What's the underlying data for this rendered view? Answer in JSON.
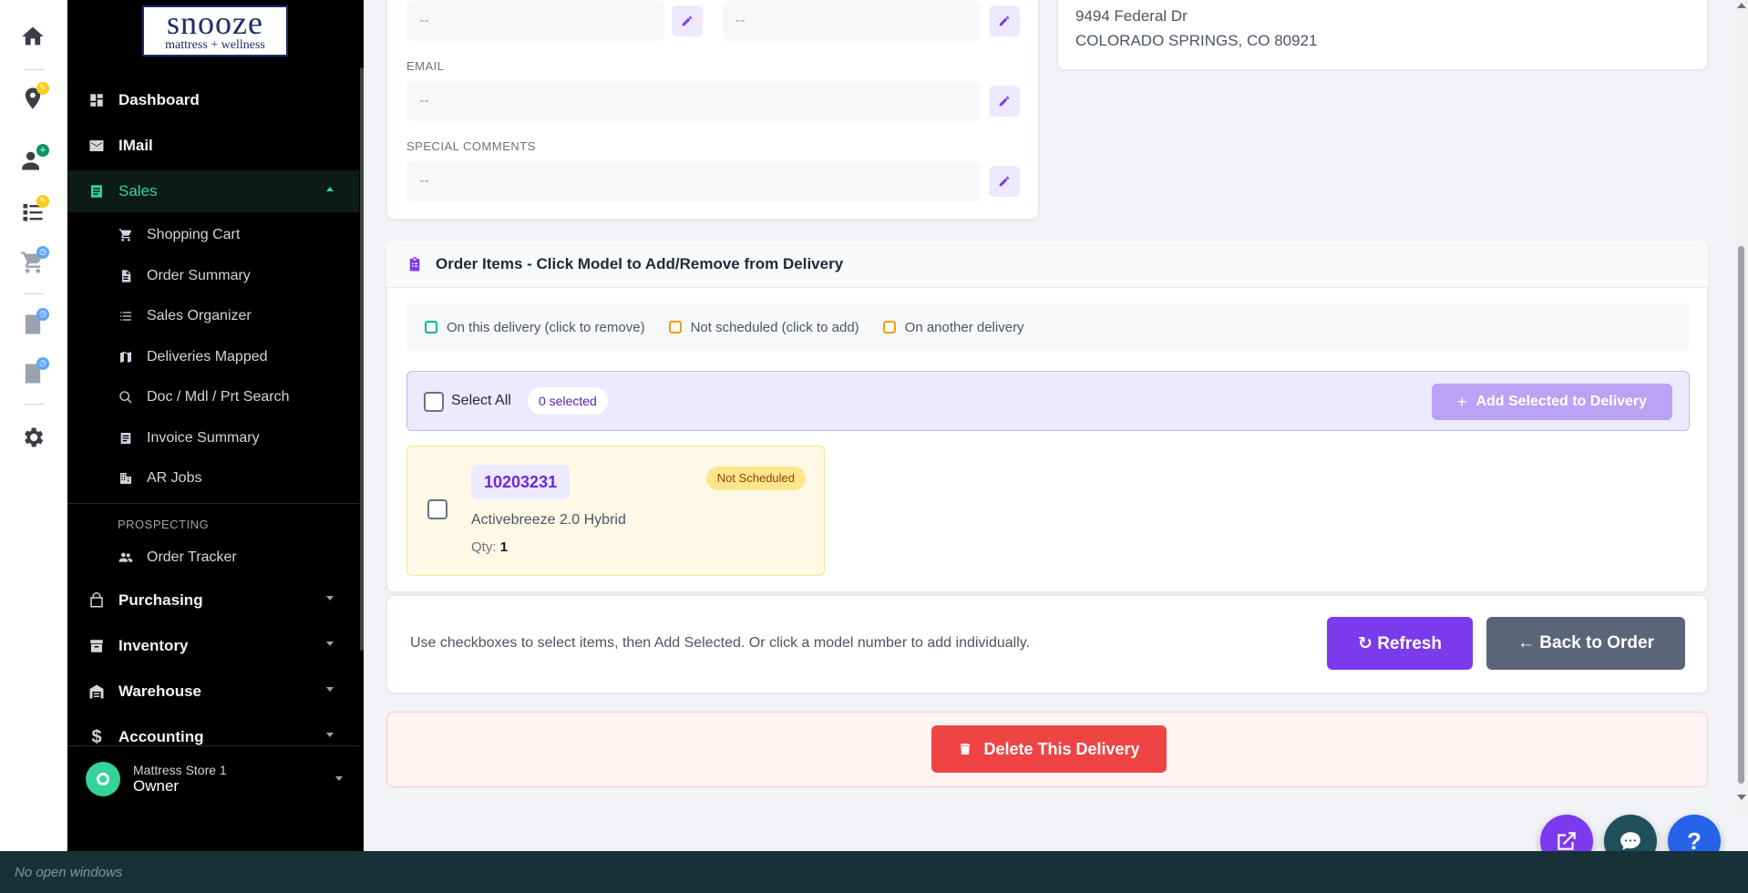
{
  "rail": {
    "items": [
      {
        "icon": "home-icon"
      },
      {
        "icon": "location-pin-icon",
        "badge_color": "#facc15"
      },
      {
        "icon": "person-add-icon",
        "badge_color": "#059669"
      },
      {
        "icon": "checklist-icon",
        "badge_color": "#facc15"
      },
      {
        "icon": "cart-icon",
        "badge_color": "#60a5fa"
      },
      {
        "icon": "report-icon",
        "badge_color": "#60a5fa"
      },
      {
        "icon": "report-icon",
        "badge_color": "#60a5fa"
      },
      {
        "icon": "gear-icon"
      }
    ]
  },
  "logo": {
    "main": "snooze",
    "sub": "mattress + wellness"
  },
  "sidebar": {
    "items": [
      {
        "label": "Dashboard",
        "icon": "dashboard-icon"
      },
      {
        "label": "IMail",
        "icon": "mail-icon"
      },
      {
        "label": "Sales",
        "icon": "receipt-icon",
        "active": true
      },
      {
        "label": "Purchasing",
        "icon": "bag-icon"
      },
      {
        "label": "Inventory",
        "icon": "archive-icon"
      },
      {
        "label": "Warehouse",
        "icon": "warehouse-icon"
      },
      {
        "label": "Accounting",
        "icon": "dollar-icon"
      }
    ],
    "sales_sub": [
      {
        "label": "Shopping Cart",
        "icon": "cart-icon"
      },
      {
        "label": "Order Summary",
        "icon": "document-icon"
      },
      {
        "label": "Sales Organizer",
        "icon": "list-icon"
      },
      {
        "label": "Deliveries Mapped",
        "icon": "map-icon"
      },
      {
        "label": "Doc / Mdl / Prt Search",
        "icon": "search-icon"
      },
      {
        "label": "Invoice Summary",
        "icon": "invoice-icon"
      },
      {
        "label": "AR Jobs",
        "icon": "building-icon"
      }
    ],
    "prospecting_title": "PROSPECTING",
    "prospecting": [
      {
        "label": "Order Tracker",
        "icon": "people-icon"
      }
    ],
    "user": {
      "store": "Mattress Store 1",
      "role": "Owner"
    }
  },
  "contact": {
    "field1": "--",
    "field2": "--",
    "email_label": "EMAIL",
    "email": "--",
    "comments_label": "SPECIAL COMMENTS",
    "comments": "--"
  },
  "address": {
    "line1": "9494 Federal Dr",
    "line2": "COLORADO SPRINGS, CO 80921"
  },
  "order_items": {
    "title": "Order Items - Click Model to Add/Remove from Delivery",
    "legend": [
      {
        "label": "On this delivery (click to remove)",
        "color": "#10b981"
      },
      {
        "label": "Not scheduled (click to add)",
        "color": "#f59e0b"
      },
      {
        "label": "On another delivery",
        "color": "#f59e0b"
      }
    ],
    "select_all": "Select All",
    "selected_count": "0 selected",
    "add_selected": "Add Selected to Delivery",
    "items": [
      {
        "model": "10203231",
        "status": "Not Scheduled",
        "description": "Activebreeze 2.0 Hybrid",
        "qty_label": "Qty:",
        "qty": "1"
      }
    ]
  },
  "footer": {
    "help": "Use checkboxes to select items, then Add Selected. Or click a model number to add individually.",
    "refresh": "↻ Refresh",
    "back": "← Back to Order",
    "delete": "Delete This Delivery"
  },
  "taskbar": {
    "text": "No open windows"
  },
  "colors": {
    "accent": "#7c3aed",
    "success": "#34d399",
    "danger": "#ef4444"
  }
}
